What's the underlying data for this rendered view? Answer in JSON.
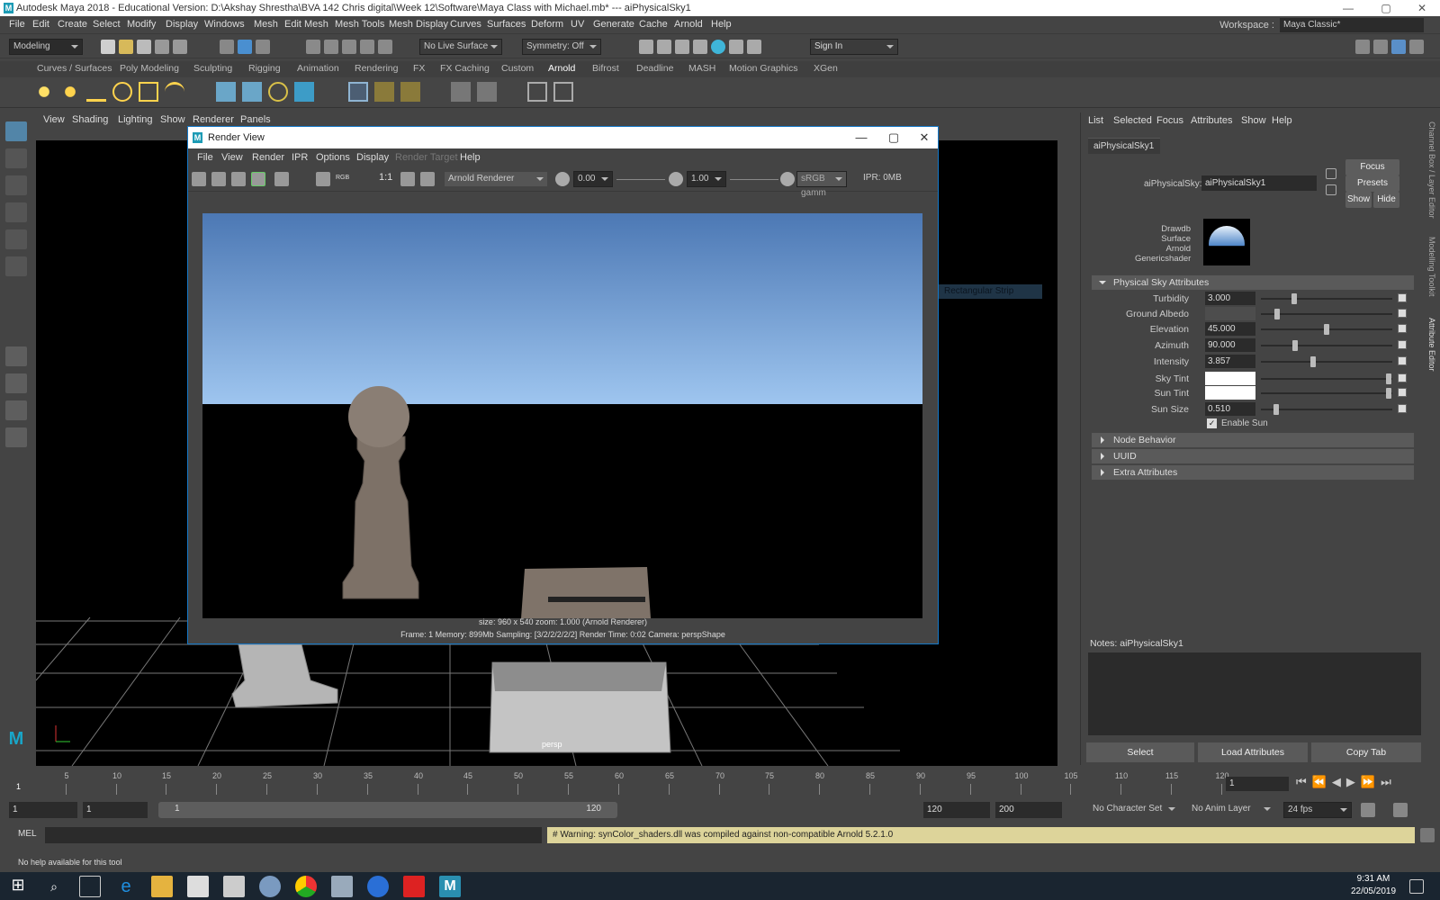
{
  "window": {
    "title": "Autodesk Maya 2018 - Educational Version: D:\\Akshay Shrestha\\BVA 142 Chris digital\\Week 12\\Software\\Maya Class with Michael.mb*   ---   aiPhysicalSky1",
    "logo": "M",
    "min": "—",
    "max": "▢",
    "close": "✕"
  },
  "menubar": {
    "items": [
      "File",
      "Edit",
      "Create",
      "Select",
      "Modify",
      "Display",
      "Windows",
      "Mesh",
      "Edit Mesh",
      "Mesh Tools",
      "Mesh Display",
      "Curves",
      "Surfaces",
      "Deform",
      "UV",
      "Generate",
      "Cache",
      "Arnold",
      "Help"
    ],
    "workspace_label": "Workspace :",
    "workspace_value": "Maya Classic*"
  },
  "statusline": {
    "mode": "Modeling",
    "live_surface": "No Live Surface",
    "symmetry": "Symmetry: Off",
    "sign_in": "Sign In"
  },
  "shelf": {
    "tabs": [
      "Curves / Surfaces",
      "Poly Modeling",
      "Sculpting",
      "Rigging",
      "Animation",
      "Rendering",
      "FX",
      "FX Caching",
      "Custom",
      "Arnold",
      "Bifrost",
      "Deadline",
      "MASH",
      "Motion Graphics",
      "XGen"
    ],
    "active": "Arnold"
  },
  "viewport": {
    "menu": [
      "View",
      "Shading",
      "Lighting",
      "Show",
      "Renderer",
      "Panels"
    ],
    "camera_label": "persp"
  },
  "render_view": {
    "title": "Render View",
    "logo": "M",
    "min": "—",
    "max": "▢",
    "close": "✕",
    "menu": [
      "File",
      "View",
      "Render",
      "IPR",
      "Options",
      "Display",
      "Render Target",
      "Help"
    ],
    "ratio": "1:1",
    "rgb": "RGB",
    "renderer": "Arnold Renderer",
    "exposure": "0.00",
    "gamma": "1.00",
    "color_space": "sRGB gamm",
    "ipr": "IPR: 0MB",
    "info_line1": "size: 960 x 540  zoom: 1.000     (Arnold Renderer)",
    "info_line2": "Frame: 1     Memory: 899Mb     Sampling: [3/2/2/2/2/2]     Render Time: 0:02     Camera: perspShape",
    "behind_label": "Rectangular Strip"
  },
  "attribute_editor": {
    "menu": [
      "List",
      "Selected",
      "Focus",
      "Attributes",
      "Show",
      "Help"
    ],
    "tab": "aiPhysicalSky1",
    "node_type_label": "aiPhysicalSky:",
    "node_name": "aiPhysicalSky1",
    "buttons": {
      "focus": "Focus",
      "presets": "Presets",
      "show": "Show",
      "hide": "Hide"
    },
    "swatch_labels": [
      "Drawdb",
      "Surface",
      "Arnold",
      "Genericshader"
    ],
    "section_title": "Physical Sky Attributes",
    "attrs": [
      {
        "label": "Turbidity",
        "value": "3.000",
        "slider": 0.24
      },
      {
        "label": "Ground Albedo",
        "value": "",
        "slider": 0.11
      },
      {
        "label": "Elevation",
        "value": "45.000",
        "slider": 0.5
      },
      {
        "label": "Azimuth",
        "value": "90.000",
        "slider": 0.25
      },
      {
        "label": "Intensity",
        "value": "3.857",
        "slider": 0.39
      },
      {
        "label": "Sky Tint",
        "value": "",
        "slider": 0.99
      },
      {
        "label": "Sun Tint",
        "value": "",
        "slider": 0.99
      },
      {
        "label": "Sun Size",
        "value": "0.510",
        "slider": 0.1
      }
    ],
    "enable_sun": "Enable Sun",
    "collapsed": [
      "Node Behavior",
      "UUID",
      "Extra Attributes"
    ],
    "notes_label": "Notes:  aiPhysicalSky1",
    "bottom": [
      "Select",
      "Load Attributes",
      "Copy Tab"
    ]
  },
  "side_tabs": [
    "Channel Box / Layer Editor",
    "Modelling Toolkit",
    "Attribute Editor"
  ],
  "timeline": {
    "ticks": [
      "5",
      "10",
      "15",
      "20",
      "25",
      "30",
      "35",
      "40",
      "45",
      "50",
      "55",
      "60",
      "65",
      "70",
      "75",
      "80",
      "85",
      "90",
      "95",
      "100",
      "105",
      "110",
      "115",
      "120"
    ],
    "first": "1",
    "current_frame": "1"
  },
  "range": {
    "start": "1",
    "playback_start": "1",
    "slider_start": "1",
    "slider_end": "120",
    "end": "120",
    "max": "200",
    "character_set": "No Character Set",
    "anim_layer": "No Anim Layer",
    "fps": "24 fps"
  },
  "command": {
    "lang": "MEL",
    "warning": "# Warning: synColor_shaders.dll was compiled against non-compatible Arnold 5.2.1.0"
  },
  "help": "No help available for this tool",
  "taskbar": {
    "time": "9:31 AM",
    "date": "22/05/2019"
  }
}
